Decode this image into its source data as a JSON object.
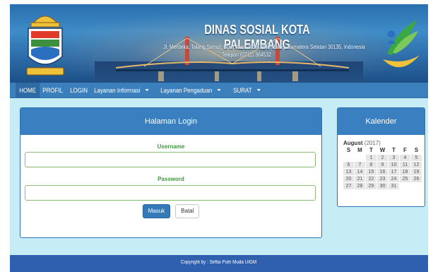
{
  "header": {
    "title": "DINAS SOSIAL KOTA PALEMBANG",
    "address": "Jl. Merdeka, Talang Semut, Bukit Kecil, Kota Palembang, Sumatera Selatan 30135, Indonesia",
    "phone": "Telepon (0711) 364532",
    "left_logo_icon": "palembang-city-emblem-icon",
    "right_logo_icon": "kemensos-social-logo-icon"
  },
  "nav": {
    "items": [
      {
        "label": "HOME",
        "dropdown": false
      },
      {
        "label": "PROFIL",
        "dropdown": false
      },
      {
        "label": "LOGIN",
        "dropdown": false
      },
      {
        "label": "Layanan Informasi",
        "dropdown": true
      },
      {
        "label": "Layanan Pengaduan",
        "dropdown": true
      },
      {
        "label": "SURAT",
        "dropdown": true
      }
    ]
  },
  "login": {
    "title": "Halaman Login",
    "username_label": "Username",
    "username_value": "",
    "password_label": "Password",
    "password_value": "",
    "submit_label": "Masuk",
    "cancel_label": "Batal"
  },
  "calendar": {
    "title": "Kalender",
    "month": "August",
    "year": "(2017)",
    "weekdays": [
      "S",
      "M",
      "T",
      "W",
      "T",
      "F",
      "S"
    ],
    "weeks": [
      [
        "",
        "",
        "1",
        "2",
        "3",
        "4",
        "5"
      ],
      [
        "6",
        "7",
        "8",
        "9",
        "10",
        "11",
        "12"
      ],
      [
        "13",
        "14",
        "15",
        "16",
        "17",
        "18",
        "19"
      ],
      [
        "20",
        "21",
        "22",
        "23",
        "24",
        "25",
        "26"
      ],
      [
        "27",
        "28",
        "29",
        "30",
        "31",
        "",
        ""
      ]
    ]
  },
  "footer": {
    "text": "Copyright by : Seftia Putri Muda UIGM"
  },
  "colors": {
    "primary_blue": "#3a7fbf",
    "page_background": "#c6ecf6",
    "label_green": "#3c9a3c",
    "footer_blue": "#2f5faf"
  }
}
